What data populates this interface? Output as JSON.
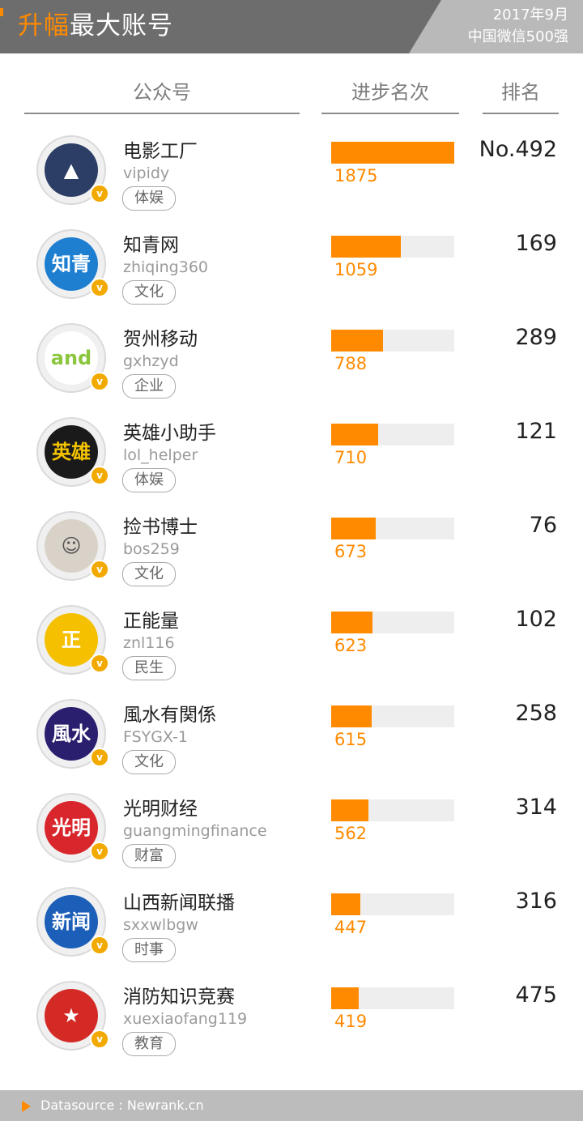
{
  "header": {
    "title_highlight": "升幅",
    "title_rest": "最大账号",
    "date": "2017年9月",
    "subtitle": "中国微信500强"
  },
  "columns": {
    "account": "公众号",
    "progress": "进步名次",
    "rank": "排名"
  },
  "footer": {
    "source": "Datasource : Newrank.cn"
  },
  "colors": {
    "accent": "#ff8a00",
    "bar_track": "#eeeeee",
    "header_bg": "#6d6d6d",
    "badge": "#f2a900"
  },
  "chart_data": {
    "type": "bar",
    "orientation": "horizontal",
    "xlim": [
      0,
      1875
    ],
    "categories": [
      "电影工厂",
      "知青网",
      "贺州移动",
      "英雄小助手",
      "捡书博士",
      "正能量",
      "風水有関係",
      "光明财经",
      "山西新闻联播",
      "消防知识竞赛"
    ],
    "values": [
      1875,
      1059,
      788,
      710,
      673,
      623,
      615,
      562,
      447,
      419
    ]
  },
  "rows": [
    {
      "name": "电影工厂",
      "id": "vipidy",
      "tag": "体娱",
      "value": "1875",
      "rank": "No.492",
      "avatar_icon": "mountain-logo-icon",
      "avatar_bg": "#2c3e66",
      "avatar_glyph": "▲",
      "avatar_color": "#ffffff"
    },
    {
      "name": "知青网",
      "id": "zhiqing360",
      "tag": "文化",
      "value": "1059",
      "rank": "169",
      "avatar_icon": "zhiqing-logo-icon",
      "avatar_bg": "#1e7fd0",
      "avatar_glyph": "知青",
      "avatar_color": "#ffffff"
    },
    {
      "name": "贺州移动",
      "id": "gxhzyd",
      "tag": "企业",
      "value": "788",
      "rank": "289",
      "avatar_icon": "and-logo-icon",
      "avatar_bg": "#ffffff",
      "avatar_glyph": "and",
      "avatar_color": "#8cc63f"
    },
    {
      "name": "英雄小助手",
      "id": "lol_helper",
      "tag": "体娱",
      "value": "710",
      "rank": "121",
      "avatar_icon": "hero-helper-logo-icon",
      "avatar_bg": "#1a1a1a",
      "avatar_glyph": "英雄",
      "avatar_color": "#f5c400"
    },
    {
      "name": "捡书博士",
      "id": "bos259",
      "tag": "文化",
      "value": "673",
      "rank": "76",
      "avatar_icon": "person-portrait-icon",
      "avatar_bg": "#d9d2c8",
      "avatar_glyph": "☺",
      "avatar_color": "#555555"
    },
    {
      "name": "正能量",
      "id": "znl116",
      "tag": "民生",
      "value": "623",
      "rank": "102",
      "avatar_icon": "sun-logo-icon",
      "avatar_bg": "#f5c000",
      "avatar_glyph": "正",
      "avatar_color": "#ffffff"
    },
    {
      "name": "風水有関係",
      "id": "FSYGX-1",
      "tag": "文化",
      "value": "615",
      "rank": "258",
      "avatar_icon": "fengshui-logo-icon",
      "avatar_bg": "#2a1f6e",
      "avatar_glyph": "風水",
      "avatar_color": "#ffffff"
    },
    {
      "name": "光明财经",
      "id": "guangmingfinance",
      "tag": "财富",
      "value": "562",
      "rank": "314",
      "avatar_icon": "guangming-logo-icon",
      "avatar_bg": "#d8262c",
      "avatar_glyph": "光明",
      "avatar_color": "#ffffff"
    },
    {
      "name": "山西新闻联播",
      "id": "sxxwlbgw",
      "tag": "时事",
      "value": "447",
      "rank": "316",
      "avatar_icon": "news-logo-icon",
      "avatar_bg": "#1c5fb8",
      "avatar_glyph": "新闻",
      "avatar_color": "#ffffff"
    },
    {
      "name": "消防知识竞赛",
      "id": "xuexiaofang119",
      "tag": "教育",
      "value": "419",
      "rank": "475",
      "avatar_icon": "fire-logo-icon",
      "avatar_bg": "#d42a26",
      "avatar_glyph": "★",
      "avatar_color": "#ffffff"
    }
  ]
}
